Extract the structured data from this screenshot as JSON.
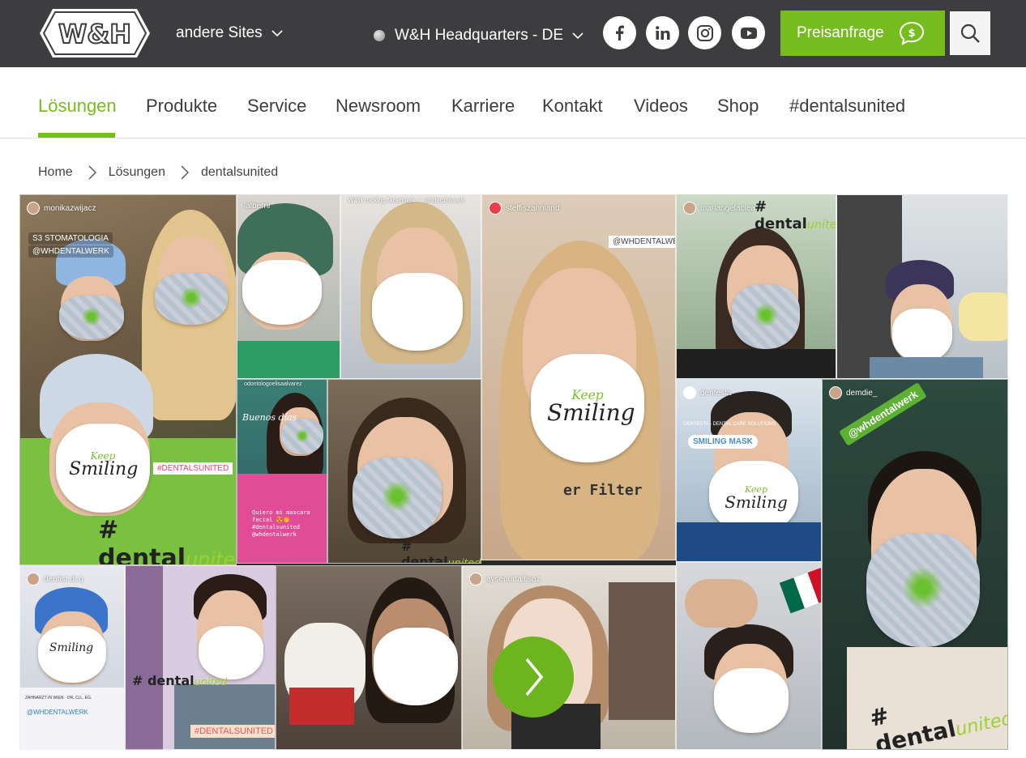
{
  "header": {
    "logo_text": "W&H",
    "sites_label": "andere Sites",
    "location_label": "W&H Headquarters - DE",
    "price_button": "Preisanfrage",
    "social": [
      "facebook-icon",
      "linkedin-icon",
      "instagram-icon",
      "youtube-icon"
    ]
  },
  "nav": {
    "items": [
      "Lösungen",
      "Produkte",
      "Service",
      "Newsroom",
      "Karriere",
      "Kontakt",
      "Videos",
      "Shop",
      "#dentalsunited"
    ],
    "active_index": 0
  },
  "breadcrumb": [
    "Home",
    "Lösungen",
    "dentalsunited"
  ],
  "collage": {
    "handles": {
      "t1": "monikazwijacz",
      "t2": "lalberni",
      "t3": "W&H rocking facemask ♡ whdentalwerk",
      "t4": "steffiszahnland",
      "t5": "mariangelaciea",
      "t7": "odontologoelisaalvarez",
      "t9": "dentesta",
      "t10": "demdie_",
      "t11": "dentist.dr.q",
      "t14": "aysenurtaltisoz"
    },
    "tags": {
      "stoma": "S3 STOMATOLOGIA",
      "whdental1": "@WHDENTALWERK",
      "dentalsunited_box": "#DENTALSUNITED",
      "whdental_box": "@WHDENTALWERK",
      "buenos": "Buenos días",
      "quiero": "Quiero mi mascara facial 😍👏 #dentalsunited @whdentalwerk",
      "smiling_mask": "SMILING MASK",
      "dentesta_note": "DENTESTA - DENTAL CARE SOLUTIONS",
      "whdental_green": "@whdentalwerk",
      "filter": "er Filter",
      "whdental_q": "@WHDENTALWERK",
      "zahnarzt": "ZAHNARZT IN WIEN · DR. CLL. EG.",
      "dentalsunited_box2": "#DENTALSUNITED"
    },
    "hashtag_main": "# dental",
    "hashtag_united": "united",
    "keep": "Keep",
    "smiling": "Smiling"
  },
  "colors": {
    "brand_green": "#77bc1f",
    "topbar": "#3d3c3f"
  }
}
